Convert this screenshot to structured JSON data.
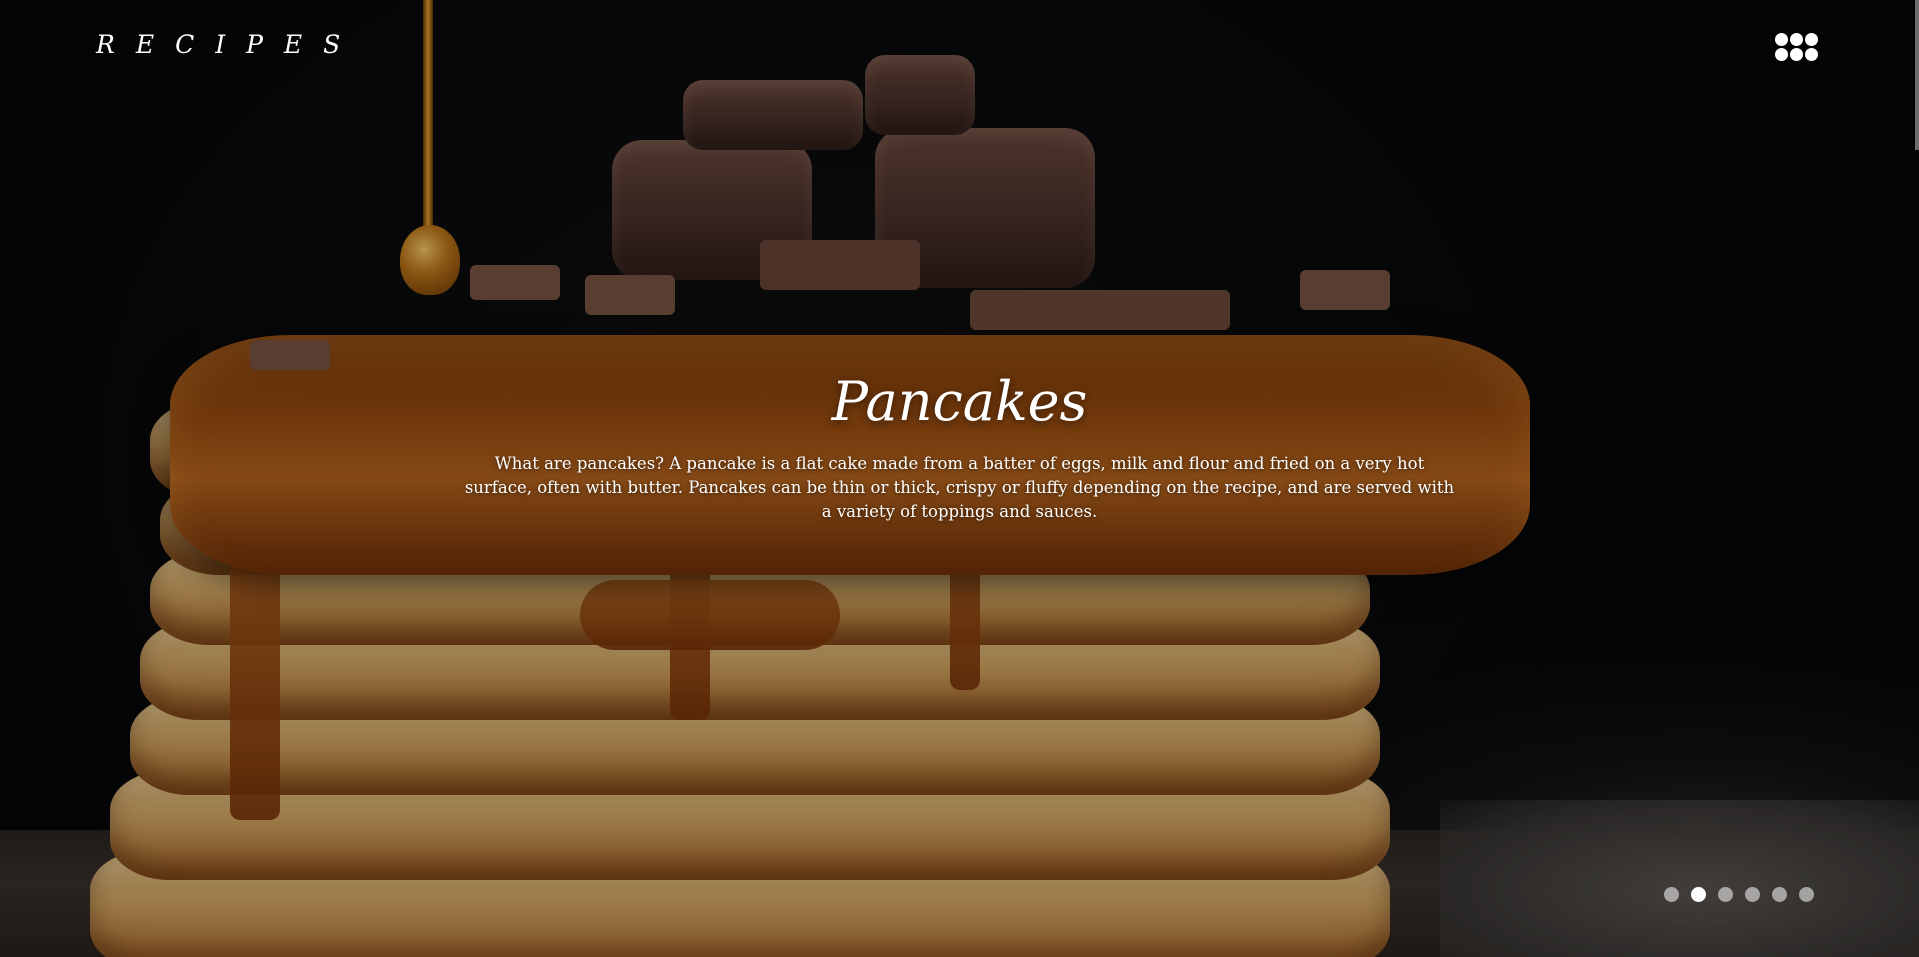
{
  "header": {
    "logo_text": "RECIPES",
    "menu_icon": "grid-dots-icon"
  },
  "slide": {
    "title": "Pancakes",
    "description": "What are pancakes? A pancake is a flat cake made from a batter of eggs, milk and flour and fried on a very hot surface, often with butter. Pancakes can be thin or thick, crispy or fluffy depending on the recipe, and are served with a variety of toppings and sauces.",
    "background_image": "pancake-stack-with-syrup-and-chocolate-photo"
  },
  "pagination": {
    "total": 6,
    "active_index": 1
  },
  "colors": {
    "text": "#ffffff",
    "dot_inactive": "#9a9a9a",
    "dot_active": "#ffffff"
  }
}
